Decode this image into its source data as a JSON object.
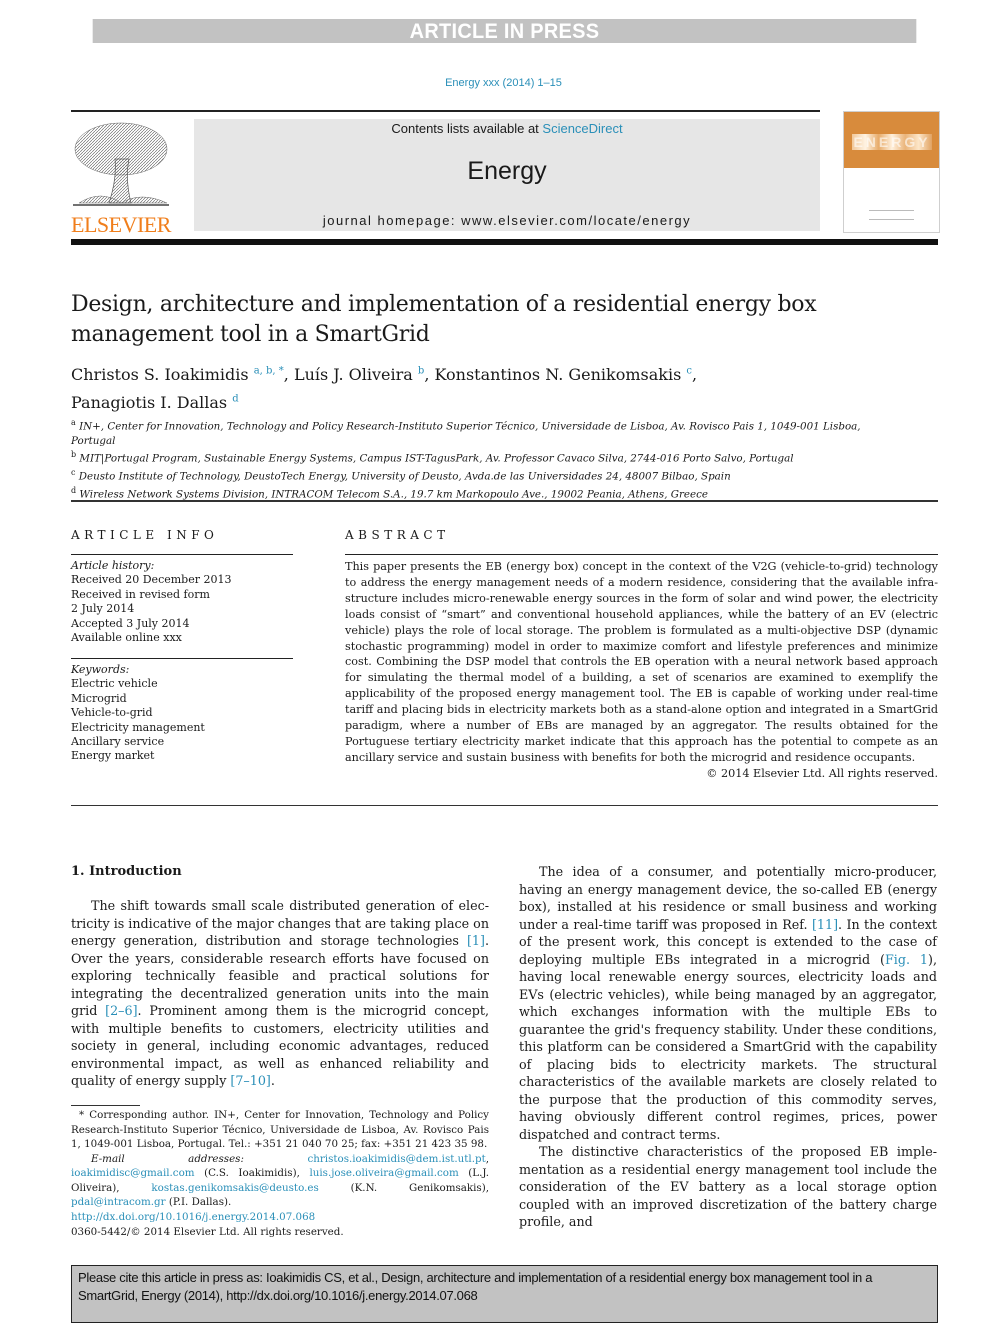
{
  "banner": "ARTICLE IN PRESS",
  "journal_citation": "Energy xxx (2014) 1–15",
  "header": {
    "publisher_logo_text": "ELSEVIER",
    "contents_prefix": "Contents lists available at ",
    "contents_link": "ScienceDirect",
    "journal_name": "Energy",
    "homepage": "journal homepage: www.elsevier.com/locate/energy",
    "cover_title": "ENERGY",
    "accent_color": "#f07e1b",
    "link_color": "#2a8fb8"
  },
  "paper": {
    "title": "Design, architecture and implementation of a residential energy box management tool in a SmartGrid",
    "authors": [
      {
        "name": "Christos S. Ioakimidis",
        "aff": "a, b, *",
        "sep": ", "
      },
      {
        "name": "Luís J. Oliveira",
        "aff": "b",
        "sep": ", "
      },
      {
        "name": "Konstantinos N. Genikomsakis",
        "aff": "c",
        "sep": ","
      },
      {
        "name": "Panagiotis I. Dallas",
        "aff": "d",
        "sep": ""
      }
    ],
    "affiliations": [
      {
        "key": "a",
        "text": "IN+, Center for Innovation, Technology and Policy Research-Instituto Superior Técnico, Universidade de Lisboa, Av. Rovisco Pais 1, 1049-001 Lisboa, Portugal"
      },
      {
        "key": "b",
        "text": "MIT|Portugal Program, Sustainable Energy Systems, Campus IST-TagusPark, Av. Professor Cavaco Silva, 2744-016 Porto Salvo, Portugal"
      },
      {
        "key": "c",
        "text": "Deusto Institute of Technology, DeustoTech Energy, University of Deusto, Avda.de las Universidades 24, 48007 Bilbao, Spain"
      },
      {
        "key": "d",
        "text": "Wireless Network Systems Division, INTRACOM Telecom S.A., 19.7 km Markopoulo Ave., 19002 Peania, Athens, Greece"
      }
    ]
  },
  "article_info": {
    "label": "ARTICLE INFO",
    "history_heading": "Article history:",
    "history": [
      "Received 20 December 2013",
      "Received in revised form",
      "2 July 2014",
      "Accepted 3 July 2014",
      "Available online xxx"
    ],
    "keywords_heading": "Keywords:",
    "keywords": [
      "Electric vehicle",
      "Microgrid",
      "Vehicle-to-grid",
      "Electricity management",
      "Ancillary service",
      "Energy market"
    ]
  },
  "abstract": {
    "label": "ABSTRACT",
    "text": "This paper presents the EB (energy box) concept in the context of the V2G (vehicle-to-grid) technology to address the energy management needs of a modern residence, considering that the available infra­structure includes micro-renewable energy sources in the form of solar and wind power, the electricity loads consist of “smart” and conventional household appliances, while the battery of an EV (electric vehicle) plays the role of local storage. The problem is formulated as a multi-objective DSP (dynamic stochastic programming) model in order to maximize comfort and lifestyle preferences and minimize cost. Combining the DSP model that controls the EB operation with a neural network based approach for simulating the thermal model of a building, a set of scenarios are examined to exemplify the applicability of the proposed energy management tool. The EB is capable of working under real-time tariff and placing bids in electricity markets both as a stand-alone option and integrated in a SmartGrid paradigm, where a number of EBs are managed by an aggregator. The results obtained for the Portuguese tertiary electricity market indicate that this approach has the potential to compete as an ancillary service and sustain business with benefits for both the microgrid and residence occupants.",
    "copyright": "© 2014 Elsevier Ltd. All rights reserved."
  },
  "body": {
    "section_heading": "1.  Introduction",
    "left_paragraph": {
      "parts": [
        {
          "t": "The shift towards small scale distributed generation of elec­tricity is indicative of the major changes that are taking place on energy generation, distribution and storage technologies "
        },
        {
          "ref": "[1]"
        },
        {
          "t": ". Over the years, considerable research efforts have focused on exploring technically feasible and practical solutions for integrating the decentralized generation units into the main grid "
        },
        {
          "ref": "[2–6]"
        },
        {
          "t": ". Prominent among them is the microgrid concept, with multiple benefits to customers, electricity utilities and society in general, including economic advantages, reduced environmental impact, as well as enhanced reliability and quality of energy supply "
        },
        {
          "ref": "[7–10]"
        },
        {
          "t": "."
        }
      ]
    },
    "right_paragraph_1": {
      "parts": [
        {
          "t": "The idea of a consumer, and potentially micro-producer, having an energy management device, the so-called EB (energy box), installed at his residence or small business and working under a real-time tariff was proposed in Ref. "
        },
        {
          "ref": "[11]"
        },
        {
          "t": ". In the context of the present work, this concept is extended to the case of deploying multiple EBs integrated in a microgrid ("
        },
        {
          "ref": "Fig. 1"
        },
        {
          "t": "), having local renewable energy sources, electricity loads and EVs (electric vehi­cles), while being managed by an aggregator, which exchanges information with the multiple EBs to guarantee the grid's frequency stability. Under these conditions, this platform can be considered a SmartGrid with the capability of placing bids to electricity markets. The structural characteristics of the available markets are closely related to the purpose that the production of this commodity serves, having obviously different control regimes, prices, power dispatched and contract terms."
        }
      ]
    },
    "right_paragraph_2": "The distinctive characteristics of the proposed EB imple­mentation as a residential energy management tool include the consideration of the EV battery as a local storage option coupled with an improved discretization of the battery charge profile, and"
  },
  "footnote": {
    "corresponding": "* Corresponding author. IN+, Center for Innovation, Technology and Policy Research-Instituto Superior Técnico, Universidade de Lisboa, Av. Rovisco Pais 1, 1049-001 Lisboa, Portugal. Tel.: +351 21 040 70 25; fax: +351 21 423 35 98.",
    "email_label": "E-mail addresses:",
    "emails": [
      {
        "addr": "christos.ioakimidis@dem.ist.utl.pt",
        "who": ", "
      },
      {
        "addr": "ioakimidisc@gmail.com",
        "who": " (C.S. Ioakimidis), "
      },
      {
        "addr": "luis.jose.oliveira@gmail.com",
        "who": " (L.J. Oliveira), "
      },
      {
        "addr": "kostas.genikomsakis@deusto.es",
        "who": " (K.N. Genikomsakis), "
      },
      {
        "addr": "pdal@intracom.gr",
        "who": " (P.I. Dallas)."
      }
    ],
    "doi": "http://dx.doi.org/10.1016/j.energy.2014.07.068",
    "issn": "0360-5442/© 2014 Elsevier Ltd. All rights reserved."
  },
  "cite_box": "Please cite this article in press as: Ioakimidis CS, et al., Design, architecture and implementation of a residential energy box management tool in a SmartGrid, Energy (2014), http://dx.doi.org/10.1016/j.energy.2014.07.068"
}
